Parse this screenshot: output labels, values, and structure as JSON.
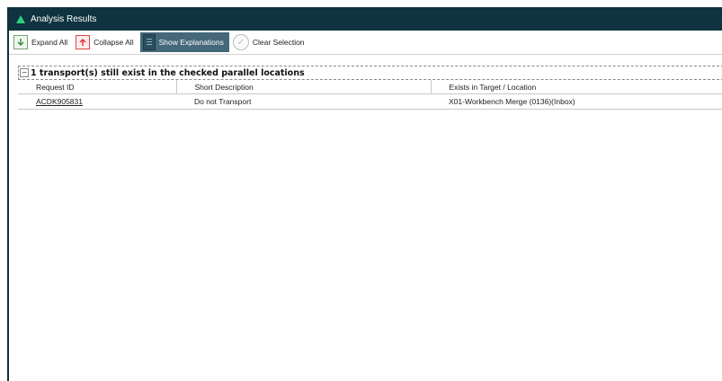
{
  "window": {
    "title": "Analysis Results"
  },
  "toolbar": {
    "expand_all": "Expand All",
    "collapse_all": "Collapse All",
    "show_explanations": "Show Explanations",
    "clear_selection": "Clear Selection"
  },
  "group": {
    "label": "1 transport(s) still exist in the checked parallel locations"
  },
  "table": {
    "columns": [
      "Request ID",
      "Short Description",
      "Exists in Target / Location"
    ],
    "rows": [
      [
        "ACDK905831",
        "Do not Transport",
        "X01-Workbench Merge (0136)(Inbox)"
      ]
    ]
  }
}
